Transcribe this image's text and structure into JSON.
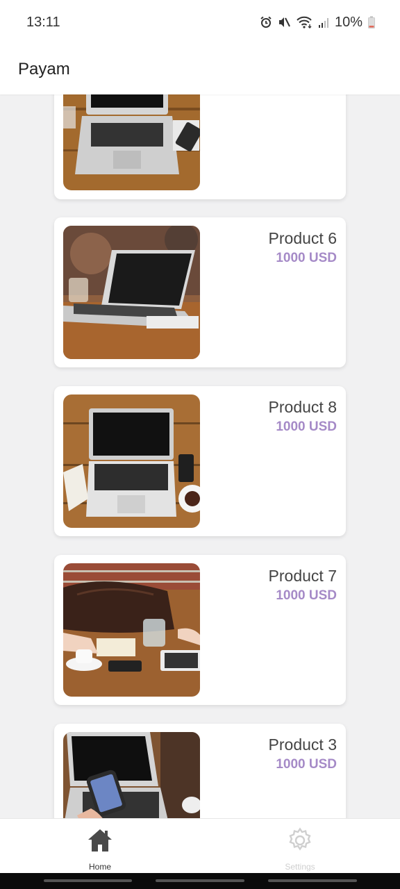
{
  "status_bar": {
    "time": "13:11",
    "battery_percent": "10%",
    "icons": [
      "alarm-icon",
      "mute-icon",
      "wifi-icon",
      "signal-icon",
      "battery-icon"
    ]
  },
  "app_bar": {
    "title": "Payam"
  },
  "products": [
    {
      "name": "",
      "price": "",
      "image": "laptop-on-desk-partial"
    },
    {
      "name": "Product 6",
      "price": "1000 USD",
      "image": "laptop-on-table"
    },
    {
      "name": "Product 8",
      "price": "1000 USD",
      "image": "laptop-phone-coffee"
    },
    {
      "name": "Product 7",
      "price": "1000 USD",
      "image": "bag-and-tablet-on-table"
    },
    {
      "name": "Product 3",
      "price": "1000 USD",
      "image": "hand-holding-phone-laptop"
    }
  ],
  "bottom_nav": {
    "items": [
      {
        "label": "Home",
        "icon": "home-icon",
        "active": true
      },
      {
        "label": "Settings",
        "icon": "gear-icon",
        "active": false
      }
    ]
  },
  "colors": {
    "price": "#a58ac7",
    "background": "#f1f1f2",
    "battery_low": "#e06a5b"
  }
}
